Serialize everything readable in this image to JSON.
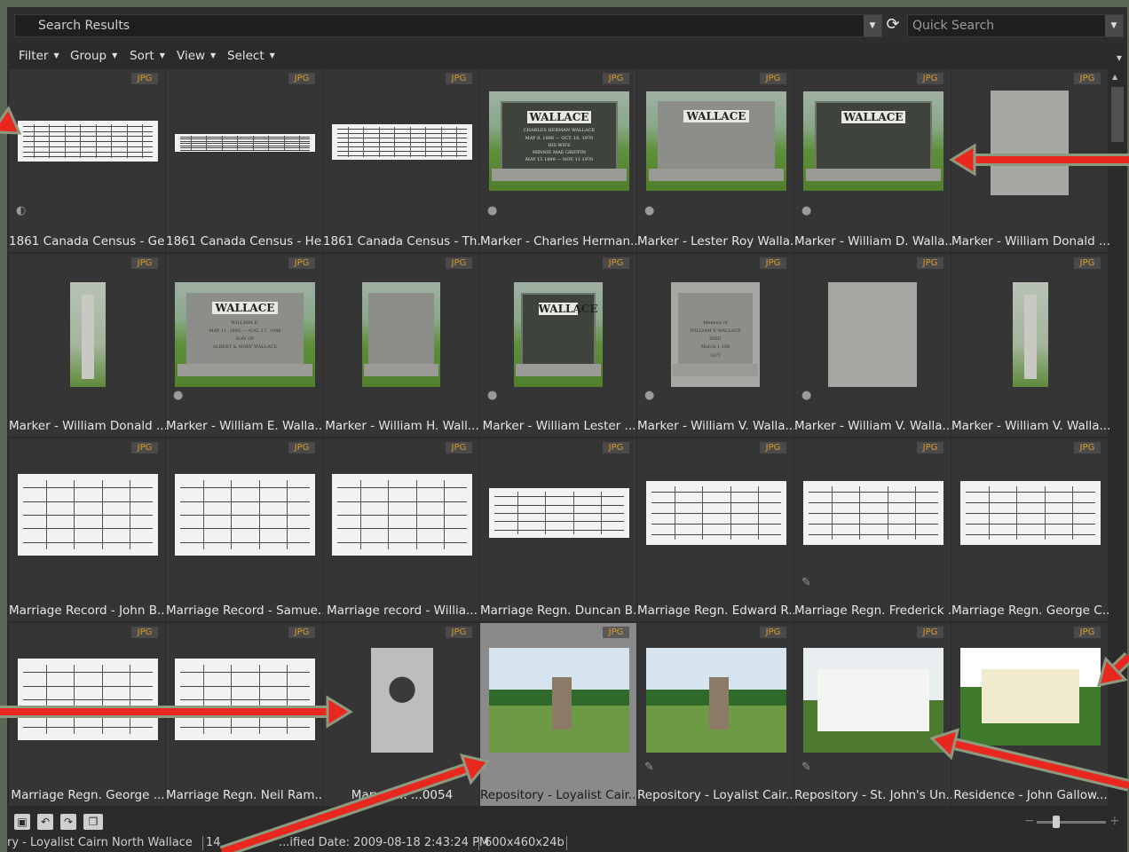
{
  "header": {
    "title": "Search Results",
    "quick_search_placeholder": "Quick Search"
  },
  "menu": {
    "filter": "Filter",
    "group": "Group",
    "sort": "Sort",
    "view": "View",
    "select": "Select"
  },
  "badge_label": "JPG",
  "items": [
    {
      "caption": "1861 Canada Census - Ge...",
      "icon": "half-circle-icon"
    },
    {
      "caption": "1861 Canada Census - He..."
    },
    {
      "caption": "1861 Canada Census - Th..."
    },
    {
      "caption": "Marker - Charles Herman...",
      "icon": "location-pin-icon",
      "stone_name": "WALLACE",
      "inscription": [
        "CHARLES HERMAN WALLACE",
        "MAY 8, 1896 — OCT. 16, 1970",
        "HIS WIFE",
        "MINNIE MAE GRIFFIN",
        "MAY 15 1899 — NOV 11 1976"
      ]
    },
    {
      "caption": "Marker - Lester Roy Walla...",
      "icon": "location-pin-icon",
      "stone_name": "WALLACE"
    },
    {
      "caption": "Marker - William D. Walla...",
      "icon": "location-pin-icon",
      "stone_name": "WALLACE"
    },
    {
      "caption": "Marker - William Donald ..."
    },
    {
      "caption": "Marker - William Donald ..."
    },
    {
      "caption": "Marker - William E. Walla...",
      "icon": "location-pin-icon",
      "stone_name": "WALLACE",
      "inscription": [
        "WILLIAM E.",
        "MAY 11, 1892 — AUG. 17, 1986",
        "SON OF",
        "ALBERT & MARY WALLACE"
      ]
    },
    {
      "caption": "Marker - William H. Wall..."
    },
    {
      "caption": "Marker - William Lester ...",
      "icon": "location-pin-icon",
      "stone_name": "WALLACE"
    },
    {
      "caption": "Marker - William V. Walla...",
      "icon": "location-pin-icon",
      "inscription": [
        "Memory of",
        "WILLIAM V WALLACE",
        "DIED",
        "March 1 188",
        "1877"
      ]
    },
    {
      "caption": "Marker - William V. Walla...",
      "icon": "location-pin-icon"
    },
    {
      "caption": "Marker - William V. Walla..."
    },
    {
      "caption": "Marriage Record - John B..."
    },
    {
      "caption": "Marriage Record - Samue..."
    },
    {
      "caption": "Marriage record - Willia..."
    },
    {
      "caption": "Marriage Regn. Duncan B..."
    },
    {
      "caption": "Marriage Regn. Edward R..."
    },
    {
      "caption": "Marriage Regn. Frederick ...",
      "icon": "pencil-icon"
    },
    {
      "caption": "Marriage Regn. George C..."
    },
    {
      "caption": "Marriage Regn. George ..."
    },
    {
      "caption": "Marriage Regn. Neil Ram..."
    },
    {
      "caption": "Mary Ja...           ...0054"
    },
    {
      "caption": "Repository - Loyalist Cair...",
      "selected": true
    },
    {
      "caption": "Repository - Loyalist Cair...",
      "icon": "pencil-icon"
    },
    {
      "caption": "Repository - St. John's Un...",
      "icon": "pencil-icon"
    },
    {
      "caption": "Residence - John Gallow..."
    }
  ],
  "status": {
    "name": "ry - Loyalist Cairn North Wallace",
    "count": "14",
    "date": "...ified Date: 2009-08-18 2:43:24 PM",
    "dimensions": "600x460x24b"
  },
  "colors": {
    "accent_badge": "#d89b2a",
    "arrow": "#e8281e",
    "arrow_outline": "#8d9a80"
  }
}
